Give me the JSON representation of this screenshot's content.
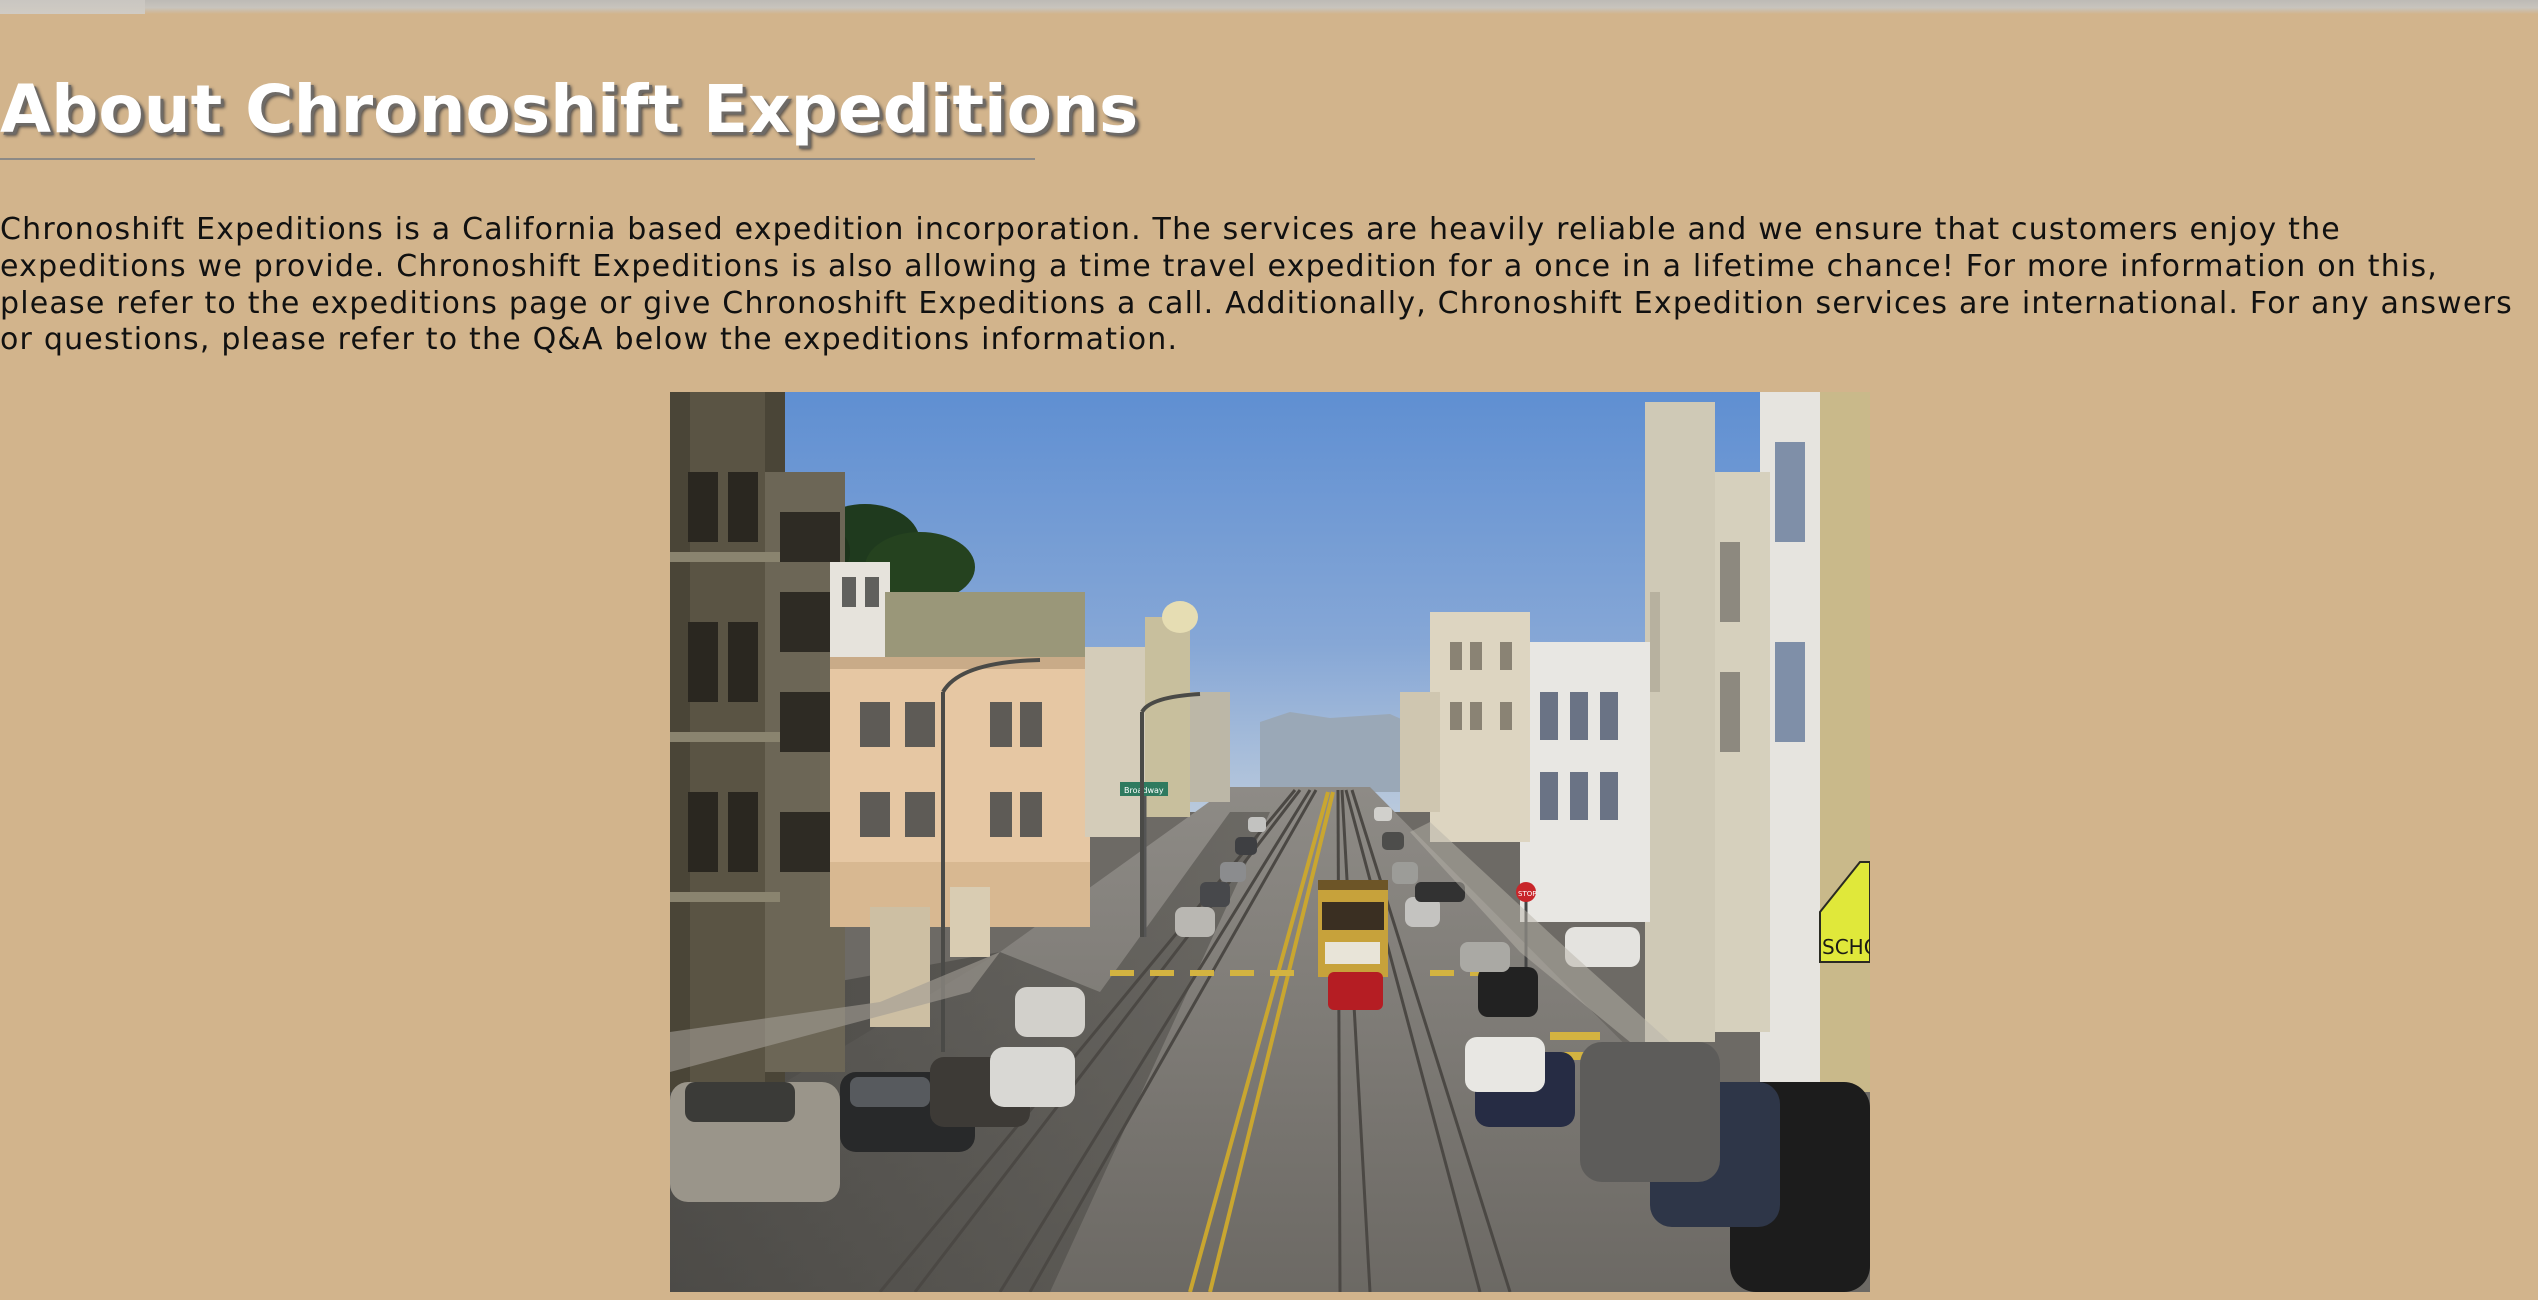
{
  "page": {
    "title": "About Chronoshift Expeditions",
    "intro_paragraph": "Chronoshift Expeditions is a California based expedition incorporation. The services are heavily reliable and we ensure that customers enjoy the expeditions we provide. Chronoshift Expeditions is also allowing a time travel expedition for a once in a lifetime chance! For more information on this, please refer to the expeditions page or give Chronoshift Expeditions a call. Additionally, Chronoshift Expedition services are international. For any answers or questions, please refer to the Q&A below the expeditions information."
  },
  "photo": {
    "street_sign_text": "Broadway",
    "stop_sign_text": "STOP",
    "school_sign_text": "SCHO"
  },
  "colors": {
    "page_background": "#d2b48c",
    "title_text": "#ffffff",
    "body_text": "#111111"
  }
}
